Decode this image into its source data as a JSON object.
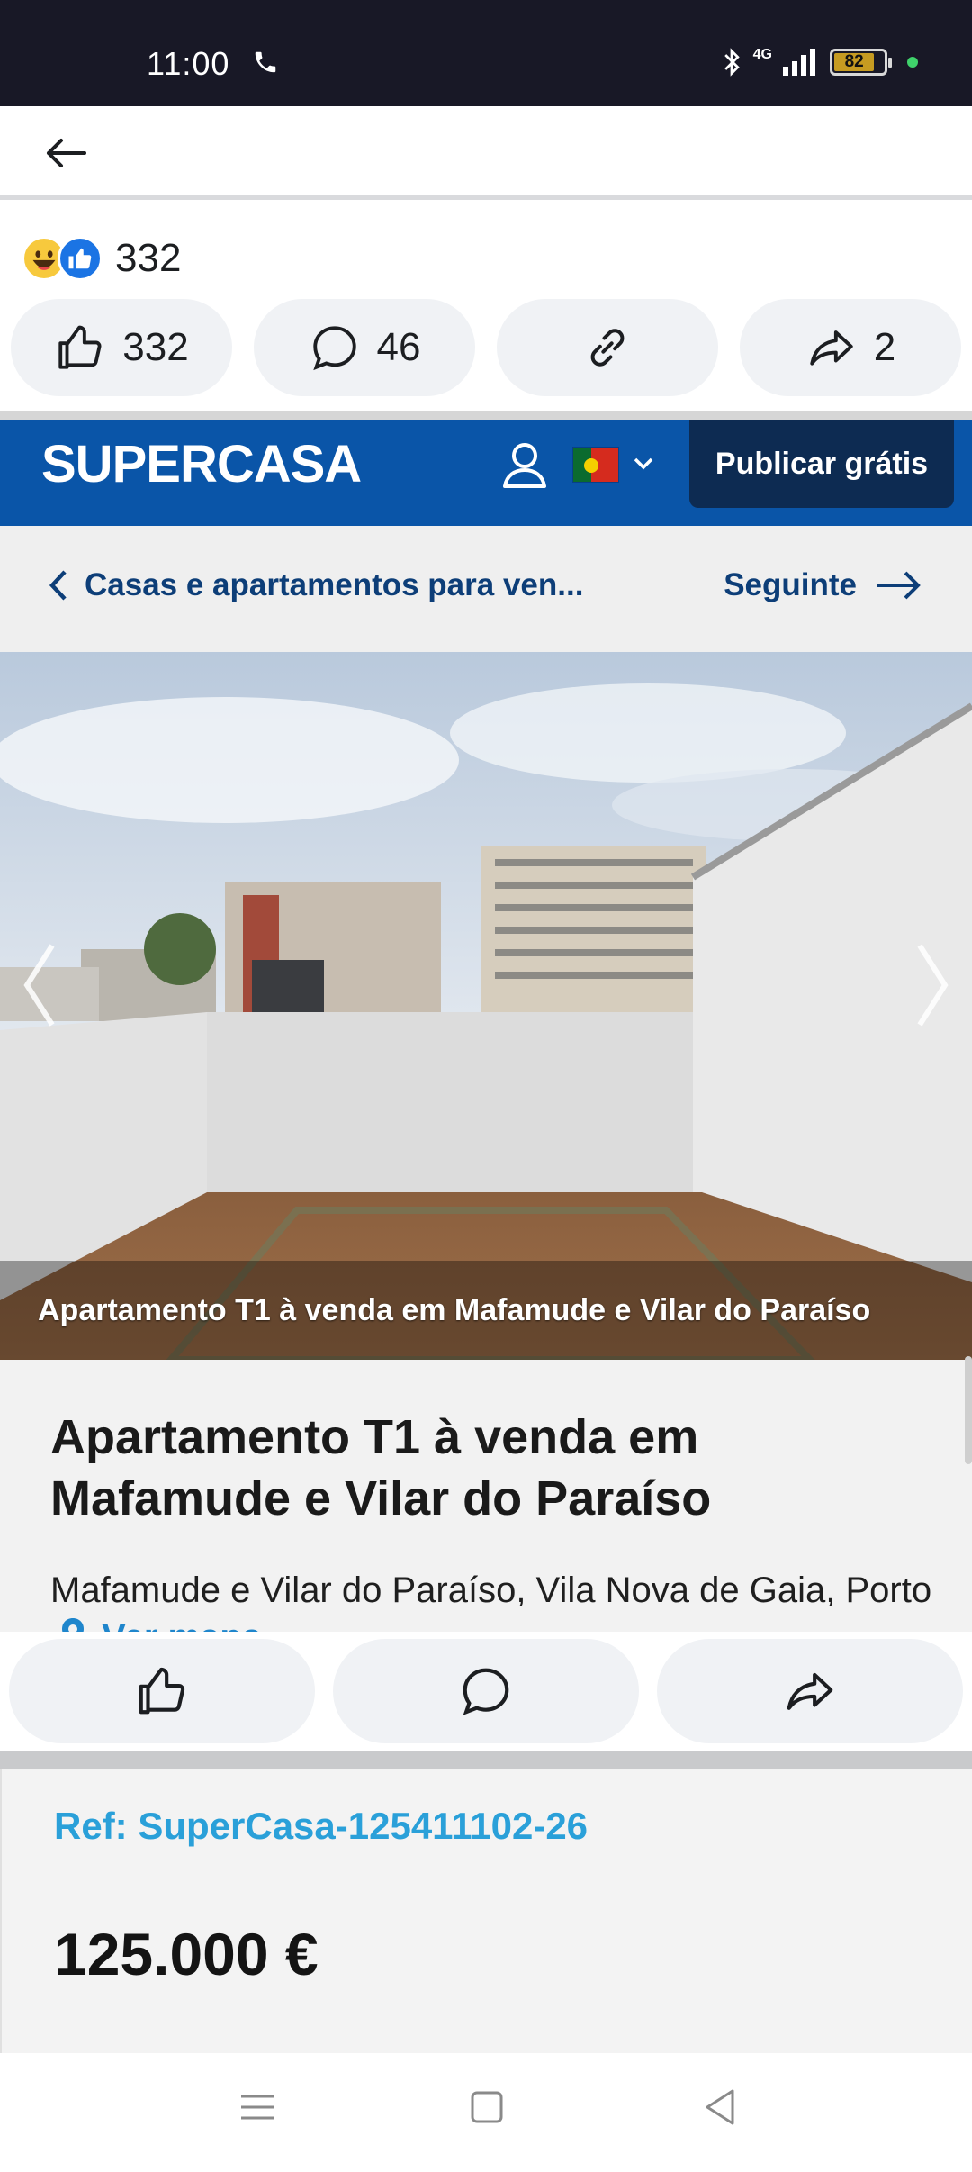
{
  "status_bar": {
    "time": "11:00",
    "battery": "82",
    "network": "4G"
  },
  "top_bar": {
    "back_icon": "arrow-left-icon"
  },
  "reactions": {
    "count": "332",
    "icons": [
      "laugh-emoji-icon",
      "like-icon"
    ]
  },
  "actions": {
    "like": {
      "count": "332",
      "icon": "thumbs-up-icon"
    },
    "comment": {
      "count": "46",
      "icon": "comment-icon"
    },
    "link": {
      "icon": "link-icon"
    },
    "share": {
      "count": "2",
      "icon": "share-icon"
    }
  },
  "supercasa": {
    "logo": "SUPERCASA",
    "publish_label": "Publicar grátis",
    "breadcrumb": "Casas e apartamentos para ven...",
    "next_label": "Seguinte",
    "photo_caption": "Apartamento T1 à venda em Mafamude e Vilar do Paraíso",
    "listing_title": "Apartamento T1 à venda em Mafamude e Vilar do Paraíso",
    "location": "Mafamude e Vilar do Paraíso, Vila Nova de Gaia, Porto",
    "map_link": "Ver mapa",
    "ref": "Ref: SuperCasa-125411102-26",
    "price": "125.000 €",
    "colors": {
      "header": "#0a55a8",
      "publish": "#0d2b52",
      "ref": "#2aa0d9"
    }
  },
  "bottom_actions": {
    "icons": [
      "thumbs-up-icon",
      "comment-icon",
      "share-icon"
    ]
  },
  "nav_bar": {
    "icons": [
      "menu-icon",
      "home-square-icon",
      "back-triangle-icon"
    ]
  }
}
